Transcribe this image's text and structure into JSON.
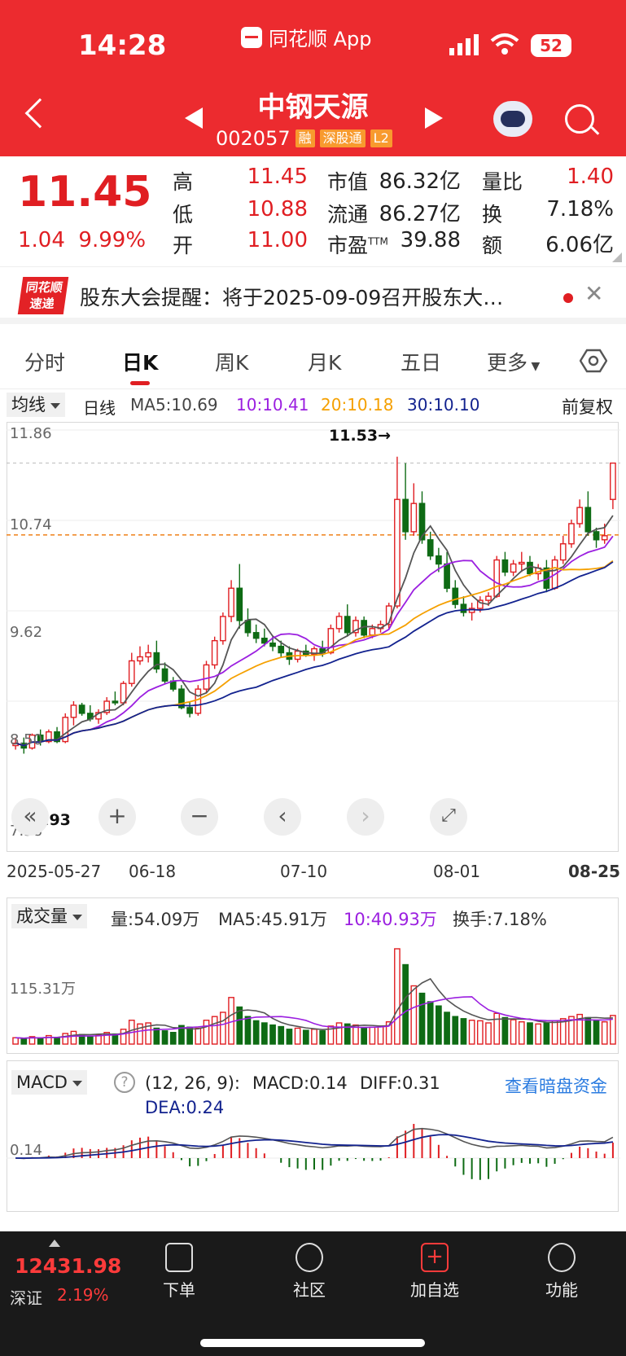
{
  "status": {
    "time": "14:28",
    "app": "同花顺 App",
    "battery": "52"
  },
  "stock": {
    "name": "中钢天源",
    "code": "002057",
    "tags": [
      "融",
      "深股通",
      "L2"
    ]
  },
  "quote": {
    "price": "11.45",
    "change": "1.04",
    "pct": "9.99%",
    "high_label": "高",
    "high": "11.45",
    "low_label": "低",
    "low": "10.88",
    "open_label": "开",
    "open": "11.00",
    "mcap_label": "市值",
    "mcap": "86.32亿",
    "float_label": "流通",
    "float": "86.27亿",
    "pe_label": "市盈",
    "pe_sup": "TTM",
    "pe": "39.88",
    "vr_label": "量比",
    "vr": "1.40",
    "turn_label": "换",
    "turn": "7.18%",
    "amt_label": "额",
    "amt": "6.06亿"
  },
  "notice": {
    "logo_top": "同花顺",
    "logo_bottom": "速递",
    "text": "股东大会提醒：将于2025-09-09召开股东大…"
  },
  "tabs": [
    "分时",
    "日K",
    "周K",
    "月K",
    "五日",
    "更多"
  ],
  "ma": {
    "selector": "均线",
    "period": "日线",
    "ma5": "MA5:10.69",
    "ma10": "10:10.41",
    "ma20": "20:10.18",
    "ma30": "30:10.10",
    "adjust": "前复权"
  },
  "kaxis": {
    "y1": "11.86",
    "y2": "10.74",
    "y3": "9.62",
    "y4": "8.50",
    "y5": "7.38",
    "peak": "11.53→",
    "low_label": "7.93"
  },
  "dates": [
    "2025-05-27",
    "06-18",
    "07-10",
    "08-01",
    "08-25"
  ],
  "vol": {
    "selector": "成交量",
    "vol": "量:54.09万",
    "ma5": "MA5:45.91万",
    "ma10": "10:40.93万",
    "turn": "换手:7.18%",
    "yaxis": "115.31万"
  },
  "macd": {
    "selector": "MACD",
    "params": "(12, 26, 9):",
    "macd": "MACD:0.14",
    "diff": "DIFF:0.31",
    "dea": "DEA:0.24",
    "link": "查看暗盘资金",
    "yaxis": "0.14"
  },
  "bottom": {
    "index": "12431.98",
    "exchange": "深证",
    "pct": "2.19%",
    "items": [
      "下单",
      "社区",
      "加自选",
      "功能"
    ]
  },
  "colors": {
    "up": "#e01e22",
    "down": "#0e6b14",
    "ma5": "#555555",
    "ma10": "#9b1fe0",
    "ma20": "#f5a000",
    "ma30": "#13238f",
    "brand": "#ec2b2f"
  },
  "chart_data": {
    "type": "candlestick",
    "title": "",
    "ylim": [
      7.38,
      11.86
    ],
    "x_ticks": [
      "2025-05-27",
      "06-18",
      "07-10",
      "08-01",
      "08-25"
    ],
    "candles": [
      [
        7.95,
        8.05,
        7.9,
        7.98
      ],
      [
        7.98,
        8.05,
        7.85,
        7.92
      ],
      [
        7.92,
        8.1,
        7.9,
        8.08
      ],
      [
        8.08,
        8.15,
        7.95,
        8.0
      ],
      [
        8.0,
        8.15,
        7.98,
        8.12
      ],
      [
        8.12,
        8.18,
        7.98,
        8.0
      ],
      [
        8.0,
        8.35,
        7.98,
        8.3
      ],
      [
        8.3,
        8.5,
        8.2,
        8.45
      ],
      [
        8.45,
        8.48,
        8.32,
        8.35
      ],
      [
        8.35,
        8.45,
        8.25,
        8.28
      ],
      [
        8.28,
        8.4,
        8.22,
        8.36
      ],
      [
        8.36,
        8.55,
        8.33,
        8.5
      ],
      [
        8.5,
        8.62,
        8.45,
        8.48
      ],
      [
        8.48,
        8.75,
        8.45,
        8.72
      ],
      [
        8.72,
        9.1,
        8.68,
        9.0
      ],
      [
        9.0,
        9.18,
        8.95,
        9.05
      ],
      [
        9.05,
        9.2,
        8.98,
        9.1
      ],
      [
        9.1,
        9.25,
        8.85,
        8.9
      ],
      [
        8.9,
        8.98,
        8.72,
        8.75
      ],
      [
        8.75,
        8.8,
        8.62,
        8.65
      ],
      [
        8.65,
        8.7,
        8.4,
        8.42
      ],
      [
        8.42,
        8.5,
        8.3,
        8.35
      ],
      [
        8.35,
        8.7,
        8.32,
        8.65
      ],
      [
        8.65,
        9.0,
        8.6,
        8.95
      ],
      [
        8.95,
        9.3,
        8.9,
        9.25
      ],
      [
        9.25,
        9.6,
        9.2,
        9.55
      ],
      [
        9.55,
        10.0,
        9.48,
        9.9
      ],
      [
        9.9,
        10.2,
        9.4,
        9.5
      ],
      [
        9.5,
        9.65,
        9.3,
        9.35
      ],
      [
        9.35,
        9.45,
        9.22,
        9.28
      ],
      [
        9.28,
        9.4,
        9.18,
        9.22
      ],
      [
        9.22,
        9.3,
        9.12,
        9.18
      ],
      [
        9.18,
        9.25,
        9.05,
        9.1
      ],
      [
        9.1,
        9.18,
        8.95,
        9.02
      ],
      [
        9.02,
        9.15,
        8.98,
        9.12
      ],
      [
        9.12,
        9.2,
        9.05,
        9.08
      ],
      [
        9.08,
        9.18,
        9.0,
        9.15
      ],
      [
        9.15,
        9.25,
        9.05,
        9.1
      ],
      [
        9.1,
        9.45,
        9.08,
        9.4
      ],
      [
        9.4,
        9.6,
        9.35,
        9.55
      ],
      [
        9.55,
        9.7,
        9.3,
        9.35
      ],
      [
        9.35,
        9.55,
        9.3,
        9.5
      ],
      [
        9.5,
        9.55,
        9.28,
        9.32
      ],
      [
        9.32,
        9.45,
        9.28,
        9.4
      ],
      [
        9.4,
        9.5,
        9.35,
        9.45
      ],
      [
        9.45,
        9.72,
        9.4,
        9.68
      ],
      [
        9.68,
        11.53,
        9.65,
        11.0
      ],
      [
        11.0,
        11.45,
        10.5,
        10.6
      ],
      [
        10.6,
        11.2,
        10.55,
        10.95
      ],
      [
        10.95,
        11.1,
        10.45,
        10.5
      ],
      [
        10.5,
        10.6,
        10.25,
        10.3
      ],
      [
        10.3,
        10.4,
        10.1,
        10.2
      ],
      [
        10.2,
        10.35,
        9.85,
        9.9
      ],
      [
        9.9,
        10.0,
        9.65,
        9.7
      ],
      [
        9.7,
        9.8,
        9.55,
        9.6
      ],
      [
        9.6,
        9.72,
        9.5,
        9.65
      ],
      [
        9.65,
        9.8,
        9.6,
        9.75
      ],
      [
        9.75,
        9.85,
        9.68,
        9.8
      ],
      [
        9.8,
        10.3,
        9.78,
        10.25
      ],
      [
        10.25,
        10.35,
        10.05,
        10.1
      ],
      [
        10.1,
        10.25,
        10.05,
        10.2
      ],
      [
        10.2,
        10.35,
        10.1,
        10.22
      ],
      [
        10.22,
        10.3,
        10.05,
        10.08
      ],
      [
        10.08,
        10.2,
        10.0,
        10.15
      ],
      [
        10.15,
        10.25,
        9.85,
        9.9
      ],
      [
        9.9,
        10.3,
        9.88,
        10.25
      ],
      [
        10.25,
        10.55,
        10.2,
        10.45
      ],
      [
        10.45,
        10.75,
        10.4,
        10.7
      ],
      [
        10.7,
        11.0,
        10.65,
        10.9
      ],
      [
        10.9,
        11.1,
        10.55,
        10.6
      ],
      [
        10.6,
        10.65,
        10.4,
        10.5
      ],
      [
        10.5,
        10.7,
        10.45,
        10.55
      ],
      [
        11.0,
        11.45,
        10.88,
        11.45
      ]
    ],
    "volume": [
      12,
      10,
      14,
      11,
      16,
      12,
      20,
      24,
      18,
      15,
      17,
      22,
      19,
      28,
      45,
      38,
      40,
      30,
      25,
      22,
      35,
      32,
      30,
      45,
      52,
      60,
      88,
      70,
      52,
      44,
      40,
      36,
      33,
      28,
      30,
      26,
      28,
      25,
      34,
      40,
      38,
      36,
      30,
      32,
      34,
      42,
      180,
      150,
      110,
      96,
      80,
      72,
      60,
      52,
      48,
      45,
      44,
      40,
      58,
      50,
      46,
      42,
      40,
      38,
      40,
      44,
      48,
      52,
      56,
      50,
      45,
      42,
      54
    ]
  }
}
